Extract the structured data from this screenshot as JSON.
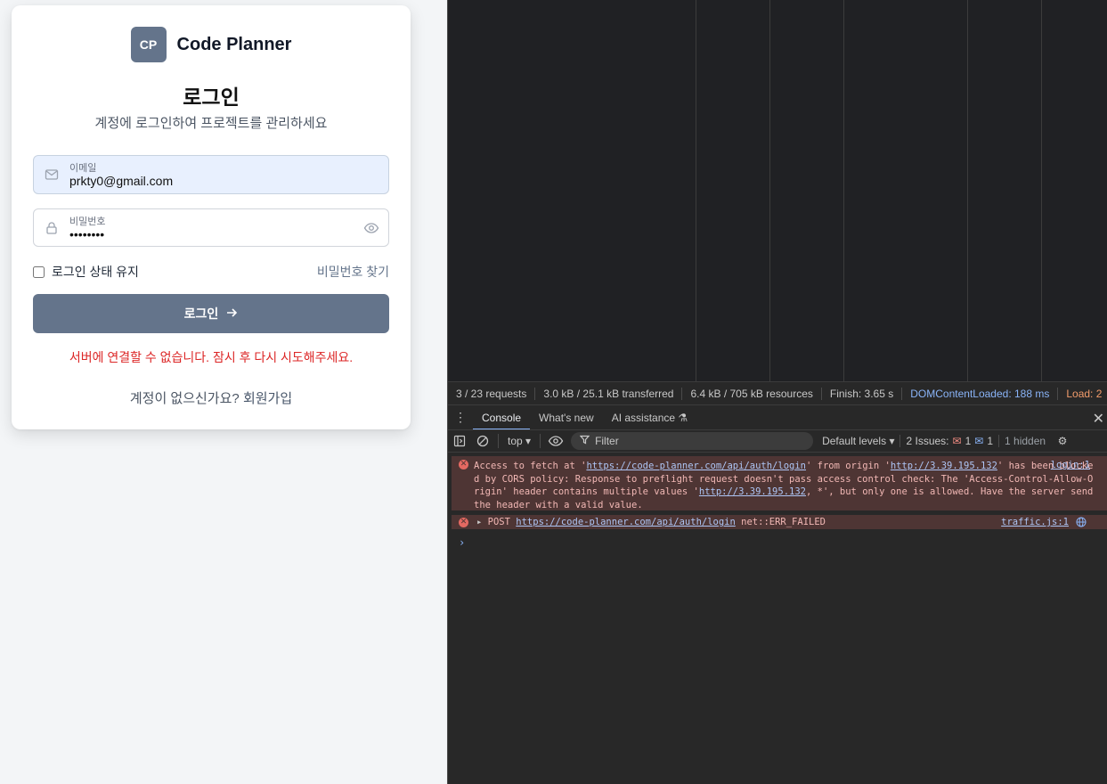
{
  "app": {
    "brand": {
      "logo_text": "CP",
      "name": "Code Planner"
    },
    "title": "로그인",
    "subtitle": "계정에 로그인하여 프로젝트를 관리하세요",
    "email": {
      "label": "이메일",
      "value": "prkty0@gmail.com"
    },
    "password": {
      "label": "비밀번호",
      "value": "••••••••"
    },
    "remember_label": "로그인 상태 유지",
    "forgot_label": "비밀번호 찾기",
    "login_button": "로그인",
    "error": "서버에 연결할 수 없습니다. 잠시 후 다시 시도해주세요.",
    "signup_prompt": "계정이 없으신가요?",
    "signup_link": "회원가입",
    "colors": {
      "primary": "#64748b",
      "error": "#dc2626"
    }
  },
  "devtools": {
    "summary": {
      "requests": "3 / 23 requests",
      "transferred": "3.0 kB / 25.1 kB transferred",
      "resources": "6.4 kB / 705 kB resources",
      "finish": "Finish: 3.65 s",
      "dcl": "DOMContentLoaded: 188 ms",
      "load": "Load: 2"
    },
    "tabs": {
      "console": "Console",
      "whats_new": "What's new",
      "ai": "AI assistance"
    },
    "toolbar": {
      "context": "top",
      "filter_placeholder": "Filter",
      "levels": "Default levels",
      "issues_label": "2 Issues:",
      "issues_err": "1",
      "issues_info": "1",
      "hidden": "1 hidden"
    },
    "messages": [
      {
        "p1": "Access to fetch at '",
        "url1": "https://code-planner.com/api/auth/login",
        "p2": "' from origin '",
        "url2": "http://3.39.195.132",
        "p3": "' has been blocked by CORS policy: Response to preflight request doesn't pass access control check: The 'Access-Control-Allow-Origin' header contains multiple values '",
        "url3": "http://3.39.195.132",
        "p4": ", *', but only one is allowed. Have the server send the header with a valid value.",
        "source": "login:1"
      },
      {
        "method": "POST",
        "url": "https://code-planner.com/api/auth/login",
        "status": "net::ERR_FAILED",
        "source": "traffic.js:1"
      }
    ],
    "prompt": "›"
  }
}
